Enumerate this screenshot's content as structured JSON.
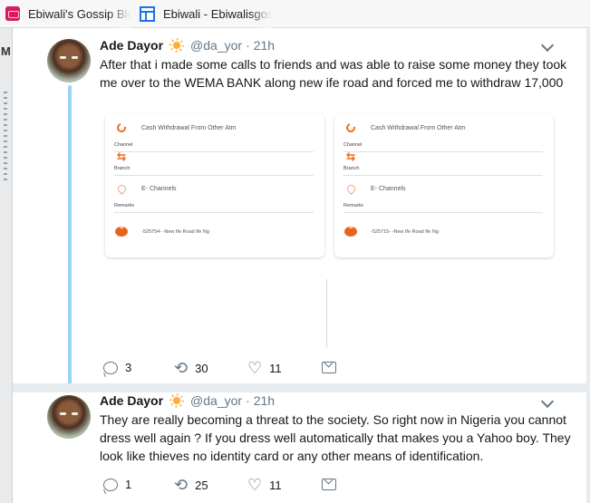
{
  "bookmarks": [
    {
      "label": "Ebiwali's Gossip Blog"
    },
    {
      "label": "Ebiwali - Ebiwalisgossip"
    }
  ],
  "left_strip": {
    "letter": "M"
  },
  "tweets": [
    {
      "name": "Ade Dayor",
      "handle": "@da_yor",
      "dot": "·",
      "time": "21h",
      "text": "After that i made some calls to friends and was able to raise some money they took me over to the WEMA BANK along new ife road and forced me to withdraw 17,000",
      "media": [
        {
          "transaction": "Cash Withdrawal From Other Atm",
          "channel_label": "Channel",
          "branch_label": "Branch",
          "branch": "E- Channels",
          "remarks_label": "Remarks",
          "remarks": "-525754- -New Ife Road Ife Ng"
        },
        {
          "transaction": "Cash Withdrawal From Other Atm",
          "channel_label": "Channel",
          "branch_label": "Branch",
          "branch": "E- Channels",
          "remarks_label": "Remarks",
          "remarks": "-525715- -New Ife Road Ife Ng"
        }
      ],
      "actions": {
        "replies": "3",
        "retweets": "30",
        "likes": "11"
      }
    },
    {
      "name": "Ade Dayor",
      "handle": "@da_yor",
      "dot": "·",
      "time": "21h",
      "text": "They are really becoming a threat to the society. So right now in Nigeria you cannot dress well again ? If you dress well automatically that makes you a Yahoo boy.  They look like thieves no identity card or any other means of identification.",
      "actions": {
        "replies": "1",
        "retweets": "25",
        "likes": "11"
      }
    }
  ],
  "icons": {
    "verified_emoji": "sun-icon",
    "reply": "reply-icon",
    "retweet": "retweet-icon",
    "like": "heart-icon",
    "dm": "direct-message-icon",
    "caret": "chevron-down-icon"
  },
  "colors": {
    "thread_line": "#9bd2f5",
    "accent_orange": "#f26b1d",
    "muted": "#657786"
  }
}
